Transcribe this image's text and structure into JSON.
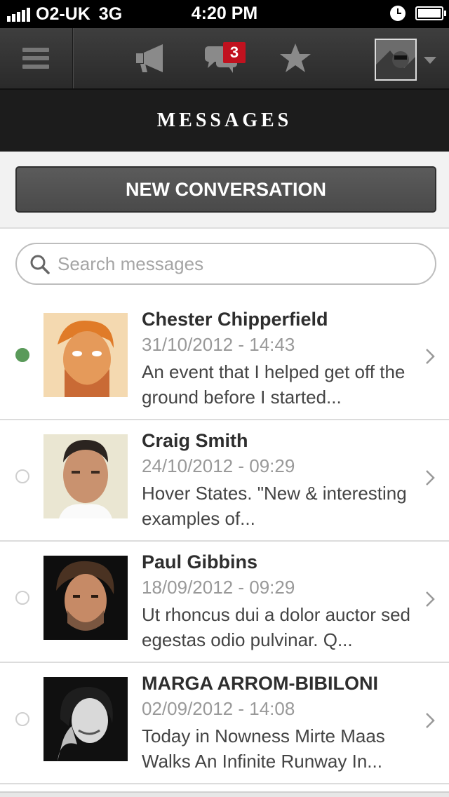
{
  "status_bar": {
    "carrier": "O2-UK",
    "network": "3G",
    "time": "4:20 PM"
  },
  "navbar": {
    "messages_badge": "3"
  },
  "page": {
    "title": "MESSAGES"
  },
  "actions": {
    "new_conversation": "NEW CONVERSATION"
  },
  "search": {
    "placeholder": "Search messages"
  },
  "conversations": [
    {
      "name": "Chester Chipperfield",
      "date": "31/10/2012 - 14:43",
      "snippet": "An event that I helped get off the ground before I started...",
      "unread": true
    },
    {
      "name": "Craig Smith",
      "date": "24/10/2012 - 09:29",
      "snippet": "Hover States. \"New & interesting examples of...",
      "unread": false
    },
    {
      "name": "Paul Gibbins",
      "date": "18/09/2012 - 09:29",
      "snippet": "Ut rhoncus dui a dolor auctor sed egestas odio pulvinar. Q...",
      "unread": false
    },
    {
      "name": "MARGA ARROM-BIBILONI",
      "date": "02/09/2012 - 14:08",
      "snippet": "Today in Nowness Mirte Maas Walks An Infinite Runway In...",
      "unread": false
    }
  ],
  "colors": {
    "unread_dot": "#5a9a5a",
    "badge": "#c1121f",
    "title_bar": "#1c1c1c"
  },
  "icons": [
    "signal-icon",
    "clock-icon",
    "battery-icon",
    "menu-icon",
    "megaphone-icon",
    "chat-bubbles-icon",
    "star-icon",
    "search-icon",
    "chevron-right-icon"
  ]
}
